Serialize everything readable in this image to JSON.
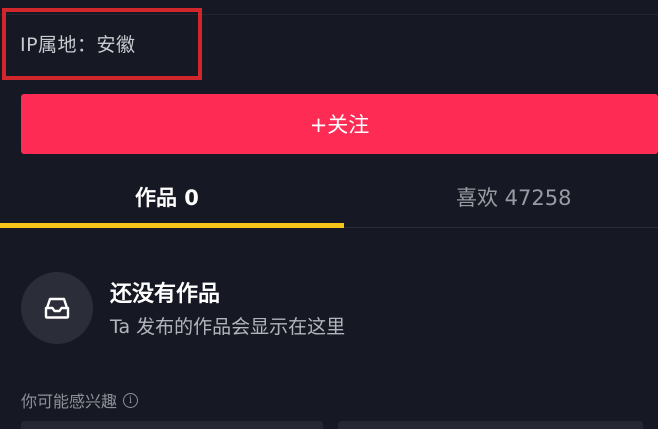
{
  "profile": {
    "ip_location_text": "IP属地：安徽"
  },
  "actions": {
    "follow_label": "+关注"
  },
  "tabs": [
    {
      "label": "作品 0",
      "active": true
    },
    {
      "label": "喜欢 47258",
      "active": false
    }
  ],
  "empty_state": {
    "icon": "inbox-tray-icon",
    "title": "还没有作品",
    "subtitle": "Ta 发布的作品会显示在这里"
  },
  "recommendations": {
    "label": "你可能感兴趣",
    "info_icon": "info-icon"
  },
  "colors": {
    "background": "#161823",
    "accent": "#fe2c55",
    "tab_indicator": "#f7c51a",
    "highlight_box": "#d2262d"
  }
}
